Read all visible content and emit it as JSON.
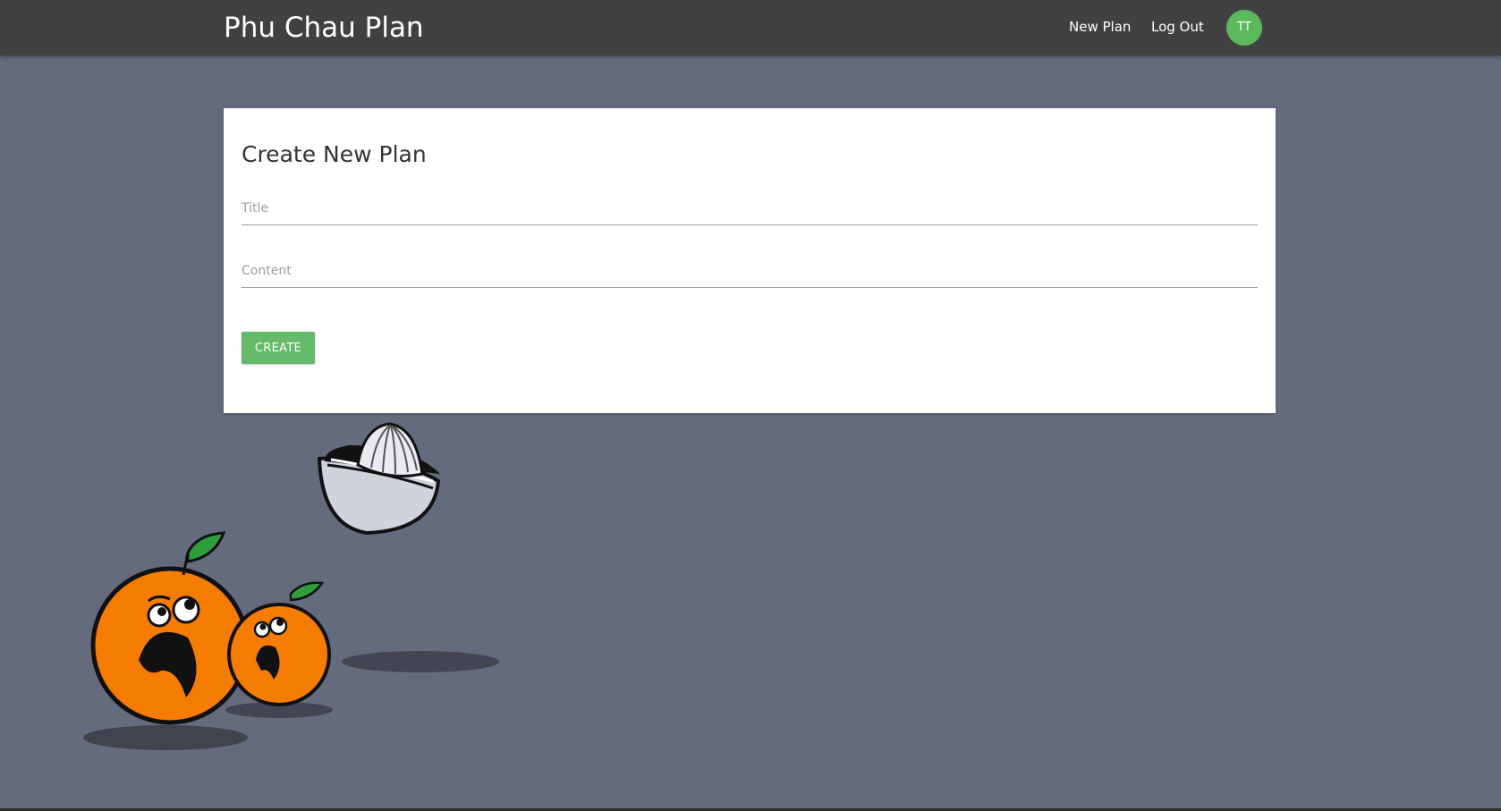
{
  "nav": {
    "brand": "Phu Chau Plan",
    "new_plan": "New Plan",
    "log_out": "Log Out",
    "avatar_initials": "TT"
  },
  "form": {
    "heading": "Create New Plan",
    "title_placeholder": "Title",
    "title_value": "",
    "content_placeholder": "Content",
    "content_value": "",
    "submit_label": "CREATE"
  },
  "colors": {
    "background": "#656b7e",
    "navbar": "#414141",
    "accent_green": "#66bb6a",
    "avatar": "#5cb85c",
    "orange": "#f57c00",
    "leaf": "#2e9e3a"
  },
  "icons": {
    "illustration": "scared-oranges-and-juicer"
  }
}
